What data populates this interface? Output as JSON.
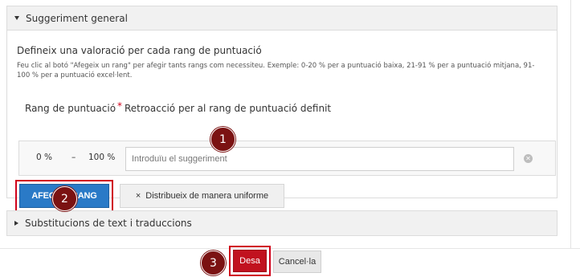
{
  "general_section": {
    "title": "Suggeriment general",
    "heading": "Defineix una valoració per cada rang de puntuació",
    "help_text": "Feu clic al botó \"Afegeix un rang\" per afegir tants rangs com necessiteu. Exemple: 0-20 % per a puntuació baixa, 21-91 % per a puntuació mitjana, 91-100 % per a puntuació excel·lent.",
    "range_label": "Rang de puntuació",
    "required_mark": "*",
    "feedback_label": "Retroacció per al rang de puntuació definit",
    "ranges": [
      {
        "from": "0 %",
        "dash": "–",
        "to": "100 %",
        "placeholder": "Introduïu el suggeriment"
      }
    ],
    "add_range_label": "AFEGEIX RANG",
    "distribute_icon": "×",
    "distribute_label": "Distribueix de manera uniforme"
  },
  "substitutions_section": {
    "title": "Substitucions de text i traduccions"
  },
  "footer": {
    "save_label": "Desa",
    "cancel_label": "Cancel·la"
  },
  "badges": [
    "1",
    "2",
    "3"
  ],
  "colors": {
    "primary_blue": "#2a7ac7",
    "save_red": "#c1121f",
    "highlight_red": "#d0021b",
    "badge_dark_red": "#7b1212"
  }
}
